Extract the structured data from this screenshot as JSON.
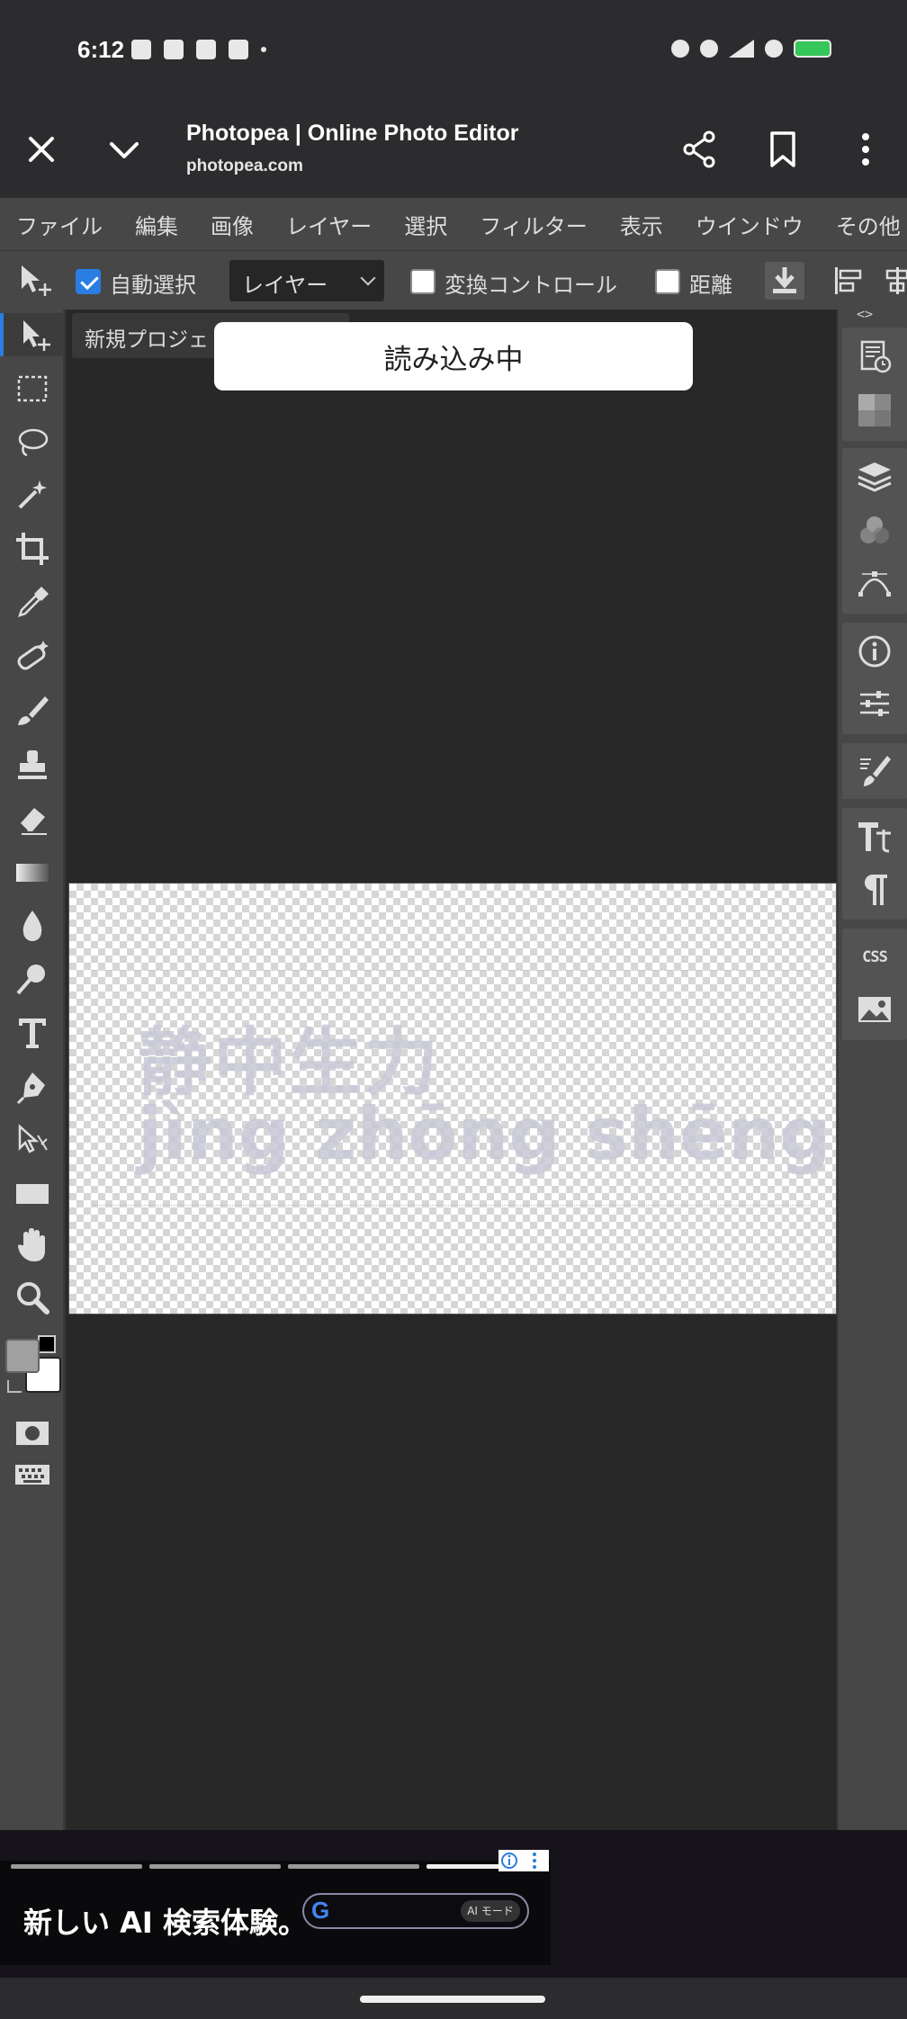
{
  "status_bar": {
    "time": "6:12"
  },
  "browser": {
    "title": "Photopea | Online Photo Editor",
    "url": "photopea.com"
  },
  "menu": {
    "items": [
      "ファイル",
      "編集",
      "画像",
      "レイヤー",
      "選択",
      "フィルター",
      "表示",
      "ウインドウ",
      "その他"
    ]
  },
  "options_bar": {
    "auto_select_label": "自動選択",
    "auto_select_checked": true,
    "select_value": "レイヤー",
    "transform_label": "変換コントロール",
    "transform_checked": false,
    "distance_label": "距離",
    "distance_checked": false
  },
  "document": {
    "tab_label": "新規プロジェ",
    "loading_text": "読み込み中",
    "canvas_line1": "静中生力",
    "canvas_line2": "jìng zhōng shēng lì"
  },
  "right_panel": {
    "toggle": "<>",
    "css_label": "CSS"
  },
  "ad": {
    "headline": "新しい AI 検索体験。",
    "mode_label": "AI モード"
  },
  "colors": {
    "accent": "#2a7de1",
    "panel": "#474747",
    "workspace": "#282828"
  }
}
